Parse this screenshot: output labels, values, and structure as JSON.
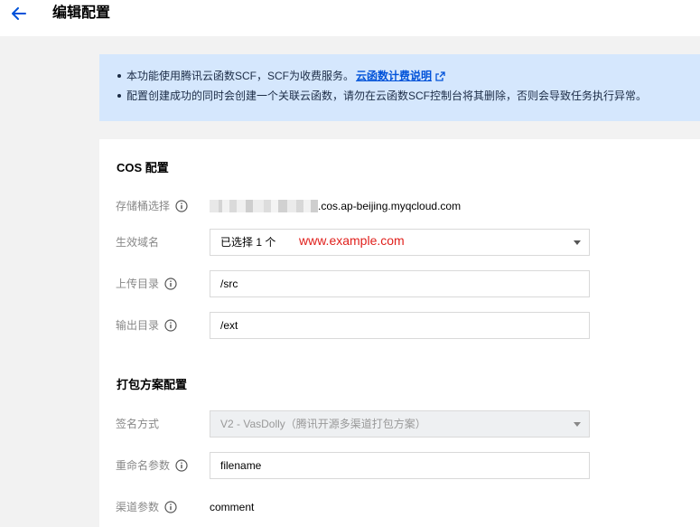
{
  "header": {
    "title": "编辑配置"
  },
  "notice": {
    "line1": "本功能使用腾讯云函数SCF，SCF为收费服务。",
    "line1_link": "云函数计费说明",
    "line2": "配置创建成功的同时会创建一个关联云函数，请勿在云函数SCF控制台将其删除，否则会导致任务执行异常。"
  },
  "cos": {
    "section_title": "COS 配置",
    "bucket_label": "存储桶选择",
    "bucket_suffix": ".cos.ap-beijing.myqcloud.com",
    "domain_label": "生效域名",
    "domain_value": "已选择 1 个",
    "domain_annotation": "www.example.com",
    "upload_label": "上传目录",
    "upload_value": "/src",
    "output_label": "输出目录",
    "output_value": "/ext"
  },
  "packaging": {
    "section_title": "打包方案配置",
    "sign_label": "签名方式",
    "sign_value": "V2 - VasDolly（腾讯开源多渠道打包方案）",
    "rename_label": "重命名参数",
    "rename_value": "filename",
    "channel_label": "渠道参数",
    "channel_value": "comment"
  },
  "colors": {
    "accent": "#0052d9",
    "notice_bg": "#d5e7fd",
    "annotation": "#e0201c"
  }
}
